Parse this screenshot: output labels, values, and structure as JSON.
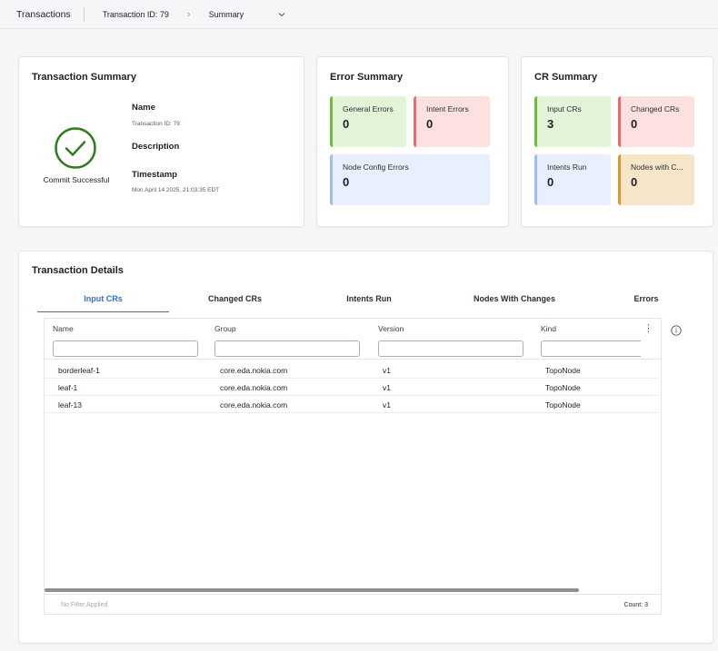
{
  "breadcrumb": {
    "root": "Transactions",
    "transaction": "Transaction ID: 79",
    "current": "Summary"
  },
  "transaction_summary": {
    "title": "Transaction Summary",
    "status": "Commit Successful",
    "name_label": "Name",
    "name_value": "Transaction ID: 79",
    "description_label": "Description",
    "timestamp_label": "Timestamp",
    "timestamp_value": "Mon April 14 2025, 21:03:35 EDT"
  },
  "error_summary": {
    "title": "Error Summary",
    "general_label": "General Errors",
    "general_value": "0",
    "intent_label": "Intent Errors",
    "intent_value": "0",
    "node_config_label": "Node Config Errors",
    "node_config_value": "0"
  },
  "cr_summary": {
    "title": "CR Summary",
    "input_label": "Input CRs",
    "input_value": "3",
    "changed_label": "Changed CRs",
    "changed_value": "0",
    "intents_label": "Intents Run",
    "intents_value": "0",
    "nodes_label": "Nodes with C...",
    "nodes_value": "0"
  },
  "details": {
    "title": "Transaction Details",
    "tabs": [
      "Input CRs",
      "Changed CRs",
      "Intents Run",
      "Nodes With Changes",
      "Errors"
    ],
    "columns": [
      "Name",
      "Group",
      "Version",
      "Kind"
    ],
    "rows": [
      {
        "name": "borderleaf-1",
        "group": "core.eda.nokia.com",
        "version": "v1",
        "kind": "TopoNode"
      },
      {
        "name": "leaf-1",
        "group": "core.eda.nokia.com",
        "version": "v1",
        "kind": "TopoNode"
      },
      {
        "name": "leaf-13",
        "group": "core.eda.nokia.com",
        "version": "v1",
        "kind": "TopoNode"
      }
    ],
    "footer_left": "No Filter Applied",
    "footer_count": "Count: 3"
  },
  "colors": {
    "accent": "#2f6fd6",
    "success": "#2e7d1e",
    "tile_green": "#e4f4d8",
    "tile_red": "#fde1e1",
    "tile_blue": "#e8f0fd",
    "tile_tan": "#f6e6c8"
  },
  "icons": {
    "status": "check-circle-icon",
    "breadcrumb_separator": "chevron-right-icon",
    "dropdown": "chevron-down-icon",
    "column_menu": "kebab-menu-icon",
    "info": "info-circle-icon"
  }
}
